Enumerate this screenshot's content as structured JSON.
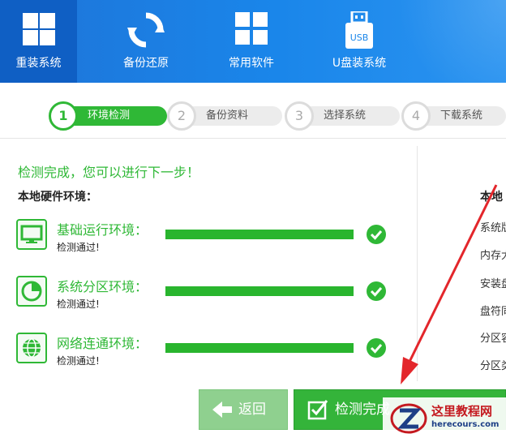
{
  "nav": {
    "items": [
      {
        "label": "重装系统",
        "icon": "windows-icon",
        "active": true
      },
      {
        "label": "备份还原",
        "icon": "refresh-icon",
        "active": false
      },
      {
        "label": "常用软件",
        "icon": "grid-icon",
        "active": false
      },
      {
        "label": "U盘装系统",
        "icon": "usb-icon",
        "active": false
      }
    ],
    "usb_text": "USB"
  },
  "steps": [
    {
      "num": "1",
      "label": "环境检测",
      "active": true
    },
    {
      "num": "2",
      "label": "备份资料",
      "active": false
    },
    {
      "num": "3",
      "label": "选择系统",
      "active": false
    },
    {
      "num": "4",
      "label": "下载系统",
      "active": false
    }
  ],
  "left_panel": {
    "status": "检测完成，您可以进行下一步！",
    "section_title": "本地硬件环境：",
    "checks": [
      {
        "title": "基础运行环境：",
        "result": "检测通过!",
        "progress": 1.0,
        "icon": "monitor-icon"
      },
      {
        "title": "系统分区环境：",
        "result": "检测通过!",
        "progress": 1.0,
        "icon": "pie-chart-icon"
      },
      {
        "title": "网络连通环境：",
        "result": "检测通过!",
        "progress": 1.0,
        "icon": "globe-icon"
      }
    ]
  },
  "right_panel": {
    "title": "本地",
    "labels": [
      "系统版",
      "内存大",
      "安装盘",
      "盘符同",
      "分区容",
      "分区类"
    ]
  },
  "buttons": {
    "back": "返回",
    "next": "检测完成"
  },
  "watermark": {
    "title": "这里教程网",
    "site": "herecours.com"
  },
  "colors": {
    "nav_blue": "#1a86ea",
    "nav_active": "#0f5fc4",
    "success_green": "#2fb836",
    "arrow_red": "#e3262b"
  }
}
